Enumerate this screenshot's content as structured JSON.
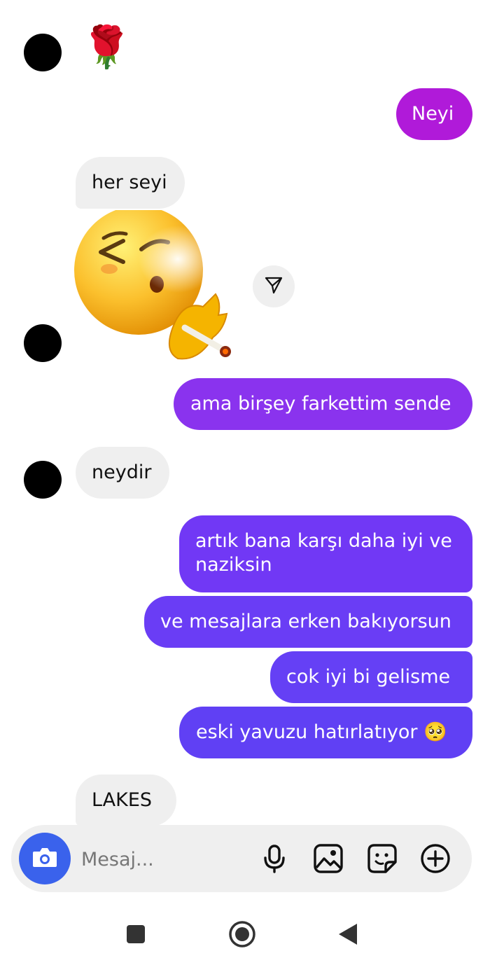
{
  "messages": [
    {
      "side": "in",
      "type": "emoji",
      "glyph": "🌹"
    },
    {
      "side": "out",
      "text": "Neyi",
      "color": "#b01ad9"
    },
    {
      "side": "in",
      "text": "her seyi"
    },
    {
      "side": "in",
      "type": "sticker",
      "name": "smoking-emoji-sticker"
    },
    {
      "side": "out",
      "text": "ama birşey farkettim sende",
      "color": "#8a33ee"
    },
    {
      "side": "in",
      "text": "neydir"
    },
    {
      "side": "out",
      "text": "artık bana karşı daha iyi ve",
      "text2": "naziksin",
      "color": "#7138f5"
    },
    {
      "side": "out",
      "text": "ve mesajlara erken bakıyorsun",
      "color": "#6a3df5"
    },
    {
      "side": "out",
      "text": "cok iyi bi gelisme",
      "color": "#6540f5"
    },
    {
      "side": "out",
      "text": "eski yavuzu hatırlatıyor 🥺",
      "color": "#6040f4"
    },
    {
      "side": "in",
      "text": "LAKES"
    }
  ],
  "composer": {
    "placeholder": "Mesaj...",
    "icons": [
      "camera-icon",
      "microphone-icon",
      "gallery-icon",
      "sticker-icon",
      "plus-circle-icon"
    ]
  },
  "navbar": {
    "icons": [
      "recents-square-icon",
      "home-circle-icon",
      "back-triangle-icon"
    ]
  },
  "colors": {
    "incoming_bubble": "#efefef",
    "camera_button": "#3a62ec"
  }
}
